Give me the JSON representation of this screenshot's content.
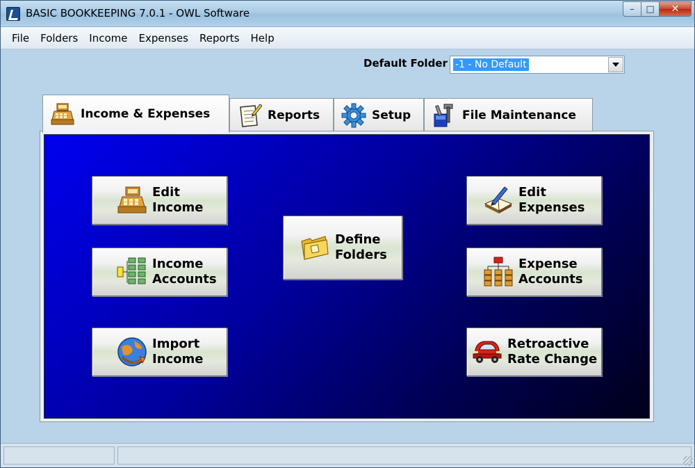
{
  "window": {
    "title": "BASIC BOOKKEEPING 7.0.1 - OWL Software",
    "minimize": "–",
    "maximize": "□",
    "close": "✕"
  },
  "menu": [
    "File",
    "Folders",
    "Income",
    "Expenses",
    "Reports",
    "Help"
  ],
  "default_folder": {
    "label": "Default Folder",
    "value": "-1 - No Default"
  },
  "tabs": [
    {
      "label": "Income & Expenses",
      "icon": "cash-register-icon",
      "active": true
    },
    {
      "label": "Reports",
      "icon": "report-pencil-icon",
      "active": false
    },
    {
      "label": "Setup",
      "icon": "gear-icon",
      "active": false
    },
    {
      "label": "File Maintenance",
      "icon": "tools-icon",
      "active": false
    }
  ],
  "buttons": {
    "edit_income": {
      "line1": "Edit",
      "line2": "Income",
      "icon": "cash-register-icon"
    },
    "income_accounts": {
      "line1": "Income",
      "line2": "Accounts",
      "icon": "tree-icon"
    },
    "import_income": {
      "line1": "Import",
      "line2": "Income",
      "icon": "globe-arrow-icon"
    },
    "define_folders": {
      "line1": "Define",
      "line2": "Folders",
      "icon": "folder-icon"
    },
    "edit_expenses": {
      "line1": "Edit",
      "line2": "Expenses",
      "icon": "book-pen-icon"
    },
    "expense_accounts": {
      "line1": "Expense",
      "line2": "Accounts",
      "icon": "org-chart-icon"
    },
    "retroactive_rate_change": {
      "line1": "Retroactive",
      "line2": "Rate Change",
      "icon": "car-icon"
    }
  },
  "colors": {
    "panel_start": "#0000f0",
    "panel_end": "#00001a",
    "selection": "#3399ff"
  }
}
